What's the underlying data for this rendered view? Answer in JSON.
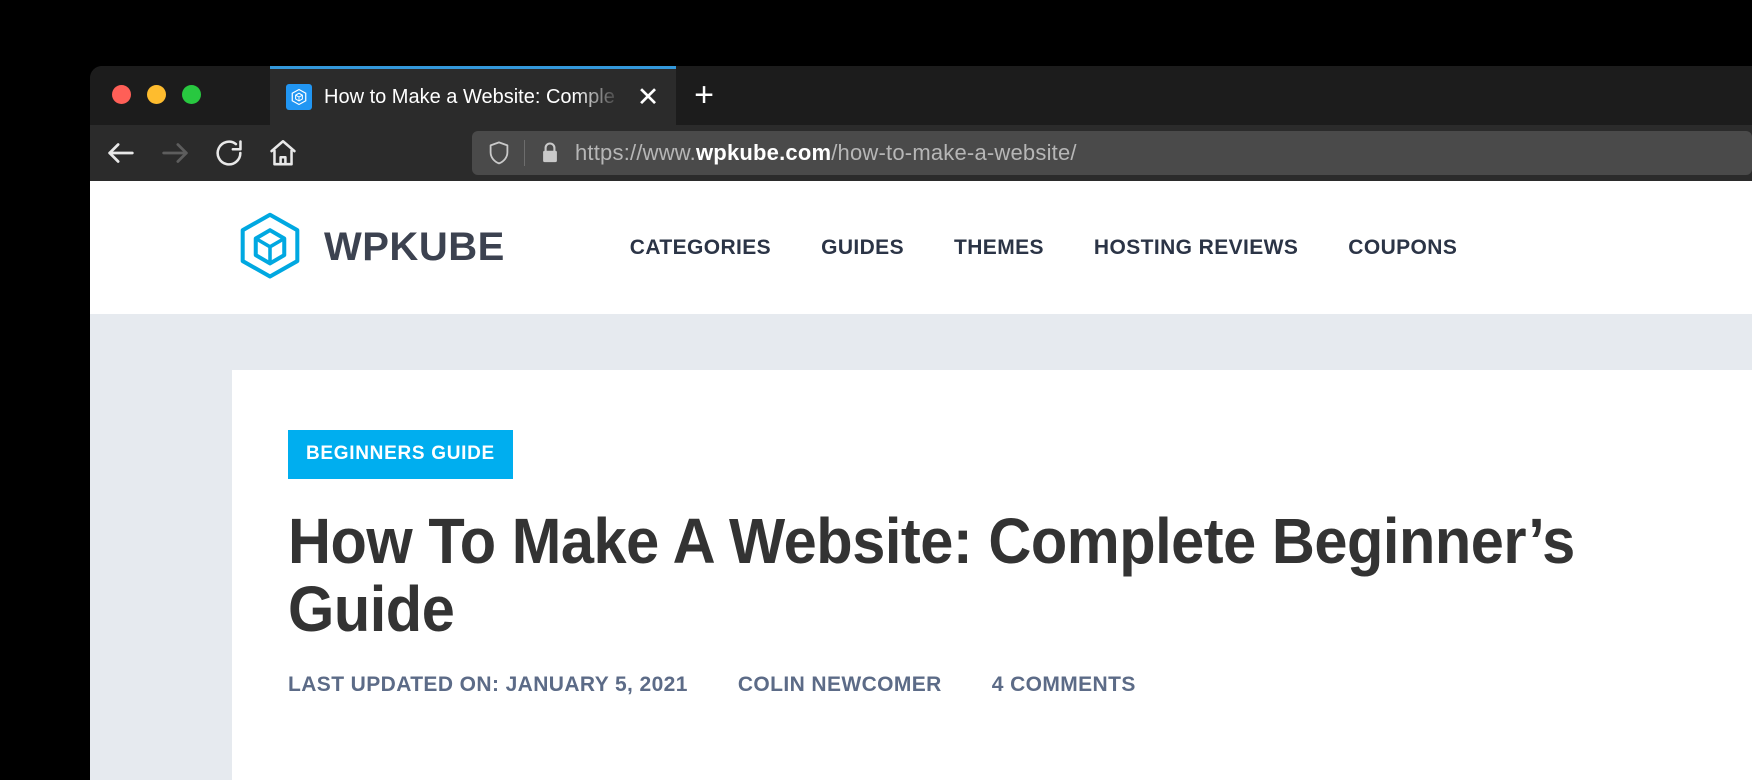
{
  "browser": {
    "traffic_lights": [
      "close",
      "minimize",
      "zoom"
    ],
    "tab": {
      "title": "How to Make a Website: Comple",
      "favicon": "wpkube-cube-icon",
      "close_label": "✕"
    },
    "new_tab_label": "+",
    "toolbar": {
      "back_icon": "arrow-left-icon",
      "forward_icon": "arrow-right-icon",
      "reload_icon": "reload-icon",
      "home_icon": "home-icon",
      "shield_icon": "shield-icon",
      "lock_icon": "padlock-icon",
      "url_prefix": "https://www.",
      "url_host": "wpkube.com",
      "url_path": "/how-to-make-a-website/",
      "url_full": "https://www.wpkube.com/how-to-make-a-website/"
    }
  },
  "site": {
    "brand": {
      "logo_icon": "wpkube-hex-cube-logo",
      "name": "WPKUBE",
      "logo_color": "#00a8e1",
      "name_color": "#3c4250"
    },
    "nav": [
      {
        "label": "CATEGORIES"
      },
      {
        "label": "GUIDES"
      },
      {
        "label": "THEMES"
      },
      {
        "label": "HOSTING REVIEWS"
      },
      {
        "label": "COUPONS"
      }
    ]
  },
  "article": {
    "category": "BEGINNERS GUIDE",
    "category_bg": "#00aeef",
    "title": "How To Make A Website: Complete Beginner’s Guide",
    "meta": {
      "updated": "LAST UPDATED ON: JANUARY 5, 2021",
      "author": "COLIN NEWCOMER",
      "comments": "4 COMMENTS"
    }
  }
}
